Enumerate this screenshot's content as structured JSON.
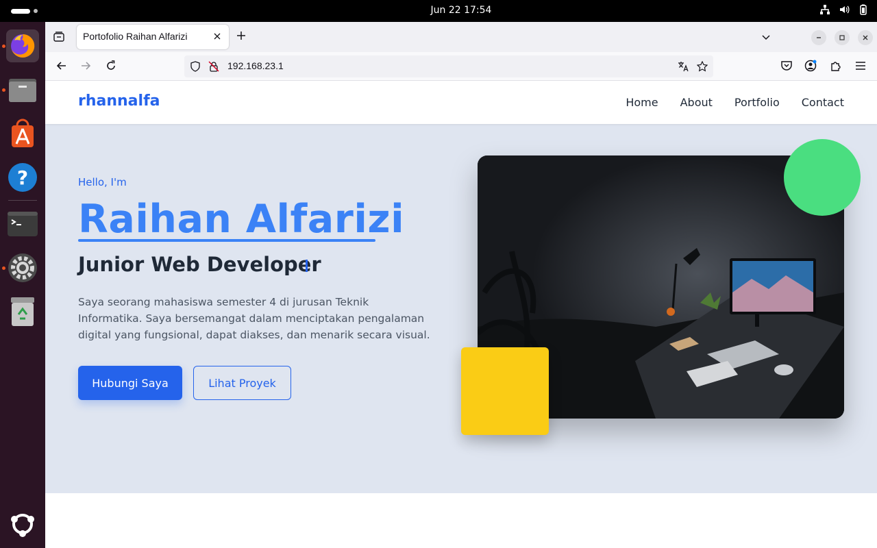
{
  "system": {
    "clock": "Jun 22  17:54"
  },
  "dock": {
    "apps": [
      "firefox-icon",
      "files-icon",
      "app-center-icon",
      "help-icon",
      "terminal-icon",
      "settings-icon",
      "trash-icon",
      "show-apps-icon"
    ]
  },
  "browser": {
    "tab_title": "Portofolio Raihan Alfarizi",
    "url": "192.168.23.1"
  },
  "site": {
    "brand": "rhannalfa",
    "nav": [
      "Home",
      "About",
      "Portfolio",
      "Contact"
    ],
    "hero": {
      "greeting": "Hello, I'm",
      "name": "Raihan Alfarizi",
      "role": "Junior Web Developer",
      "description": "Saya seorang mahasiswa semester 4 di jurusan Teknik Informatika. Saya bersemangat dalam menciptakan pengalaman digital yang fungsional, dapat diakses, dan menarik secara visual.",
      "primary_button": "Hubungi Saya",
      "secondary_button": "Lihat Proyek"
    }
  },
  "colors": {
    "accent": "#2563eb",
    "hero_bg": "#dfe5f0",
    "green_circle": "#4ade80",
    "yellow_square": "#facc15"
  }
}
